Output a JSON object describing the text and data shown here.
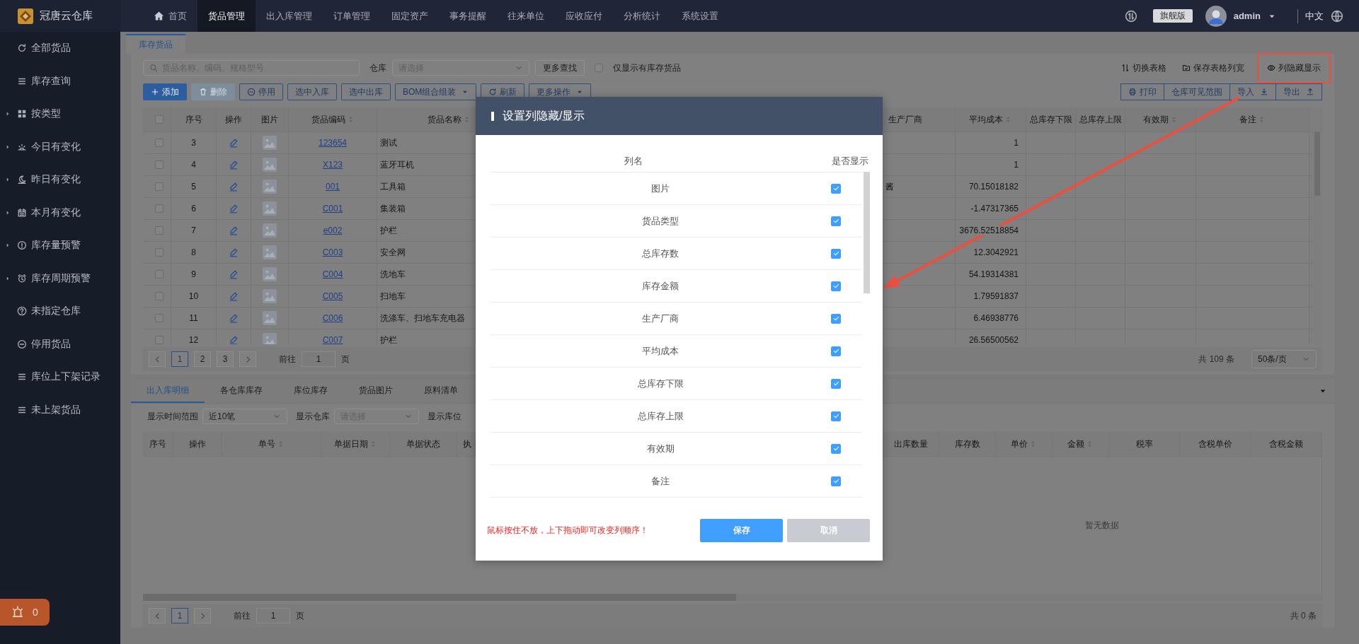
{
  "app": {
    "name": "冠唐云仓库"
  },
  "nav": [
    {
      "label": "首页",
      "kind": "home",
      "selected": false
    },
    {
      "label": "货品管理",
      "kind": "text",
      "selected": true
    },
    {
      "label": "出入库管理",
      "kind": "text",
      "selected": false
    },
    {
      "label": "订单管理",
      "kind": "text",
      "selected": false
    },
    {
      "label": "固定资产",
      "kind": "text",
      "selected": false
    },
    {
      "label": "事务提醒",
      "kind": "text",
      "selected": false
    },
    {
      "label": "往来单位",
      "kind": "text",
      "selected": false
    },
    {
      "label": "应收应付",
      "kind": "text",
      "selected": false
    },
    {
      "label": "分析统计",
      "kind": "text",
      "selected": false
    },
    {
      "label": "系统设置",
      "kind": "text",
      "selected": false
    }
  ],
  "header_right": {
    "edition": "旗舰版",
    "user": "admin",
    "language": "中文"
  },
  "sidebar": [
    {
      "label": "全部货品",
      "collapsible": false
    },
    {
      "label": "库存查询",
      "collapsible": false
    },
    {
      "label": "按类型",
      "collapsible": true
    },
    {
      "label": "今日有变化",
      "collapsible": true
    },
    {
      "label": "昨日有变化",
      "collapsible": true
    },
    {
      "label": "本月有变化",
      "collapsible": true
    },
    {
      "label": "库存量预警",
      "collapsible": true
    },
    {
      "label": "库存周期预警",
      "collapsible": true
    },
    {
      "label": "未指定仓库",
      "collapsible": false
    },
    {
      "label": "停用货品",
      "collapsible": false
    },
    {
      "label": "库位上下架记录",
      "collapsible": false
    },
    {
      "label": "未上架货品",
      "collapsible": false
    }
  ],
  "alarm": {
    "count": "0"
  },
  "page_tabs": [
    {
      "label": "库存货品",
      "selected": true
    }
  ],
  "toolbar": {
    "search": {
      "placeholder": "货品名称、编码、规格型号"
    },
    "warehouse": {
      "label": "仓库",
      "placeholder": "请选择"
    },
    "more_search": "更多查找",
    "in_stock_only": {
      "label": "仅显示有库存货品",
      "checked": false
    },
    "view_actions": [
      {
        "label": "切换表格",
        "highlighted": false
      },
      {
        "label": "保存表格列宽",
        "highlighted": false
      },
      {
        "label": "列隐藏显示",
        "highlighted": true
      }
    ]
  },
  "actions": [
    {
      "label": "添加",
      "kind": "primary",
      "disabled": false
    },
    {
      "label": "删除",
      "kind": "primary",
      "disabled": true
    },
    {
      "label": "停用",
      "kind": "outline",
      "disabled": false
    },
    {
      "label": "选中入库",
      "kind": "outline",
      "disabled": false
    },
    {
      "label": "选中出库",
      "kind": "outline",
      "disabled": false
    },
    {
      "label": "BOM组合组装",
      "kind": "dropdown",
      "disabled": false
    },
    {
      "label": "刷新",
      "kind": "outline",
      "disabled": false
    },
    {
      "label": "更多操作",
      "kind": "dropdown",
      "disabled": false
    }
  ],
  "right_actions": [
    {
      "label": "打印"
    },
    {
      "label": "仓库可见范围"
    },
    {
      "label": "导入"
    },
    {
      "label": "导出"
    }
  ],
  "table": {
    "header_checked": false,
    "columns": [
      {
        "label": "序号",
        "kind": "center",
        "sortable": false
      },
      {
        "label": "操作",
        "kind": "edit",
        "sortable": false
      },
      {
        "label": "图片",
        "kind": "image",
        "sortable": false
      },
      {
        "label": "货品编码",
        "kind": "link",
        "sortable": true
      },
      {
        "label": "货品名称",
        "kind": "text",
        "sortable": true
      },
      {
        "label": "生产厂商",
        "kind": "text",
        "sortable": false
      },
      {
        "label": "平均成本",
        "kind": "number",
        "sortable": true
      },
      {
        "label": "总库存下限",
        "kind": "text",
        "sortable": false
      },
      {
        "label": "总库存上限",
        "kind": "text",
        "sortable": false
      },
      {
        "label": "有效期",
        "kind": "text",
        "sortable": true
      },
      {
        "label": "备注",
        "kind": "text",
        "sortable": true
      }
    ],
    "rows": [
      {
        "selected": false,
        "no": "3",
        "code": "123654",
        "name": "测试",
        "avg_cost": "1"
      },
      {
        "selected": false,
        "no": "4",
        "code": "X123",
        "name": "蓝牙耳机",
        "avg_cost": "1"
      },
      {
        "selected": false,
        "no": "5",
        "code": "001",
        "name": "工具箱",
        "maker": "酱",
        "avg_cost": "70.15018182"
      },
      {
        "selected": false,
        "no": "6",
        "code": "C001",
        "name": "集装箱",
        "avg_cost": "-1.47317365"
      },
      {
        "selected": false,
        "no": "7",
        "code": "e002",
        "name": "护栏",
        "avg_cost": "3676.52518854"
      },
      {
        "selected": false,
        "no": "8",
        "code": "C003",
        "name": "安全网",
        "avg_cost": "12.3042921"
      },
      {
        "selected": false,
        "no": "9",
        "code": "C004",
        "name": "洗地车",
        "avg_cost": "54.19314381"
      },
      {
        "selected": false,
        "no": "10",
        "code": "C005",
        "name": "扫地车",
        "avg_cost": "1.79591837"
      },
      {
        "selected": false,
        "no": "11",
        "code": "C006",
        "name": "洗涤车、扫地车充电器",
        "avg_cost": "6.46938776"
      },
      {
        "selected": false,
        "no": "12",
        "code": "C007",
        "name": "护栏",
        "avg_cost": "26.56500562"
      }
    ],
    "pagination": {
      "pages": [
        {
          "label": "1",
          "selected": true
        },
        {
          "label": "2",
          "selected": false
        },
        {
          "label": "3",
          "selected": false
        }
      ],
      "goto_label": "前往",
      "goto_value": "1",
      "page_unit": "页",
      "total": "共 109 条",
      "page_size": "50条/页"
    }
  },
  "detail_tabs": [
    {
      "label": "出入库明细",
      "selected": true
    },
    {
      "label": "各仓库库存",
      "selected": false
    },
    {
      "label": "库位库存",
      "selected": false
    },
    {
      "label": "货品图片",
      "selected": false
    },
    {
      "label": "原料清单",
      "selected": false
    }
  ],
  "detail_filters": [
    {
      "label": "显示时间范围",
      "value": "近10笔"
    },
    {
      "label": "显示仓库",
      "placeholder": "请选择"
    },
    {
      "label": "显示库位"
    }
  ],
  "detail_table": {
    "columns": [
      {
        "label": "序号",
        "sortable": false
      },
      {
        "label": "操作",
        "sortable": false
      },
      {
        "label": "单号",
        "sortable": true
      },
      {
        "label": "单据日期",
        "sortable": true
      },
      {
        "label": "单据状态",
        "sortable": false
      },
      {
        "label": "执",
        "sortable": false
      },
      {
        "label": "出库数量",
        "sortable": false
      },
      {
        "label": "库存数",
        "sortable": false
      },
      {
        "label": "单价",
        "sortable": true
      },
      {
        "label": "金额",
        "sortable": true
      },
      {
        "label": "税率",
        "sortable": false
      },
      {
        "label": "含税单价",
        "sortable": false
      },
      {
        "label": "含税金额",
        "sortable": false
      }
    ],
    "empty_text": "暂无数据",
    "pagination": {
      "pages": [
        {
          "label": "1",
          "selected": true
        }
      ],
      "goto_label": "前往",
      "goto_value": "1",
      "page_unit": "页",
      "total": "共 0 条"
    }
  },
  "modal": {
    "title": "设置列隐藏/显示",
    "headers": [
      "列名",
      "是否显示"
    ],
    "rows": [
      {
        "label": "图片",
        "checked": true
      },
      {
        "label": "货品类型",
        "checked": true
      },
      {
        "label": "总库存数",
        "checked": true
      },
      {
        "label": "库存金额",
        "checked": true
      },
      {
        "label": "生产厂商",
        "checked": true
      },
      {
        "label": "平均成本",
        "checked": true
      },
      {
        "label": "总库存下限",
        "checked": true
      },
      {
        "label": "总库存上限",
        "checked": true
      },
      {
        "label": "有效期",
        "checked": true
      },
      {
        "label": "备注",
        "checked": true
      }
    ],
    "hint": "鼠标按住不放，上下拖动即可改变列顺序！",
    "buttons": [
      {
        "label": "保存",
        "kind": "primary"
      },
      {
        "label": "取消",
        "kind": "secondary"
      }
    ]
  }
}
